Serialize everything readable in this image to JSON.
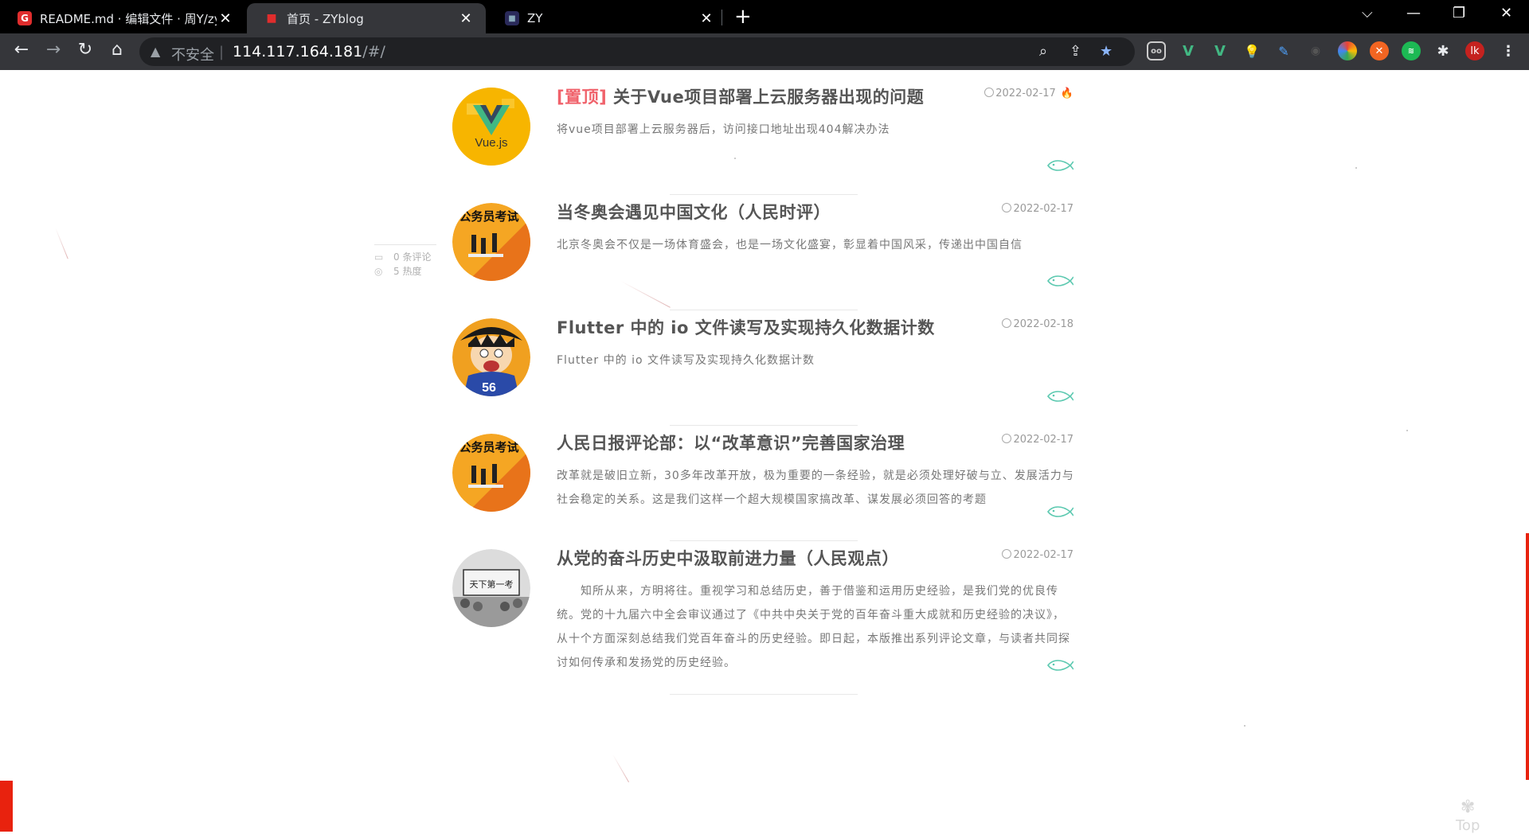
{
  "browser": {
    "tabs": [
      {
        "title": "README.md · 编辑文件 · 周Y/zy",
        "favicon": "G",
        "favicon_color": "#e02d2d"
      },
      {
        "title": "首页 - ZYblog",
        "favicon": "■",
        "favicon_color": "#e02d2d"
      },
      {
        "title": "ZY",
        "favicon": "■",
        "favicon_color": "#3a3a8c"
      }
    ],
    "insecure_label": "不安全",
    "url_host": "114.117.164.181",
    "url_path": "/#/",
    "profile_initials": "lk"
  },
  "posts": [
    {
      "pinned": true,
      "pin_label": "[置顶]",
      "title": "关于Vue项目部署上云服务器出现的问题",
      "date": "2022-02-17",
      "desc": "将vue项目部署上云服务器后，访问接口地址出现404解决办法",
      "avatar": "vue-logo",
      "avatar_text": "Vue.js"
    },
    {
      "pinned": false,
      "title": "当冬奥会遇见中国文化（人民时评）",
      "date": "2022-02-17",
      "desc": "北京冬奥会不仅是一场体育盛会，也是一场文化盛宴，彰显着中国风采，传递出中国自信",
      "avatar": "civil-exam",
      "avatar_text": "公务员考试"
    },
    {
      "pinned": false,
      "title": "Flutter 中的 io 文件读写及实现持久化数据计数",
      "date": "2022-02-18",
      "desc": "Flutter 中的 io 文件读写及实现持久化数据计数",
      "avatar": "luffy",
      "avatar_text": "56"
    },
    {
      "pinned": false,
      "title": "人民日报评论部：以“改革意识”完善国家治理",
      "date": "2022-02-17",
      "desc": "改革就是破旧立新，30多年改革开放，极为重要的一条经验，就是必须处理好破与立、发展活力与社会稳定的关系。这是我们这样一个超大规模国家搞改革、谋发展必须回答的考题",
      "avatar": "civil-exam",
      "avatar_text": "公务员考试"
    },
    {
      "pinned": false,
      "title": "从党的奋斗历史中汲取前进力量（人民观点）",
      "date": "2022-02-17",
      "desc": "　　知所从来，方明将往。重视学习和总结历史，善于借鉴和运用历史经验，是我们党的优良传统。党的十九届六中全会审议通过了《中共中央关于党的百年奋斗重大成就和历史经验的决议》，从十个方面深刻总结我们党百年奋斗的历史经验。即日起，本版推出系列评论文章，与读者共同探讨如何传承和发扬党的历史经验。",
      "avatar": "exam-banner",
      "avatar_text": "天下第一考"
    }
  ],
  "hover_meta": {
    "comments": "0 条评论",
    "heat": "5 热度"
  },
  "top_button": "Top",
  "colors": {
    "accent": "#f0626b",
    "fish": "#5cc9b0",
    "badge": "#e8220e"
  }
}
